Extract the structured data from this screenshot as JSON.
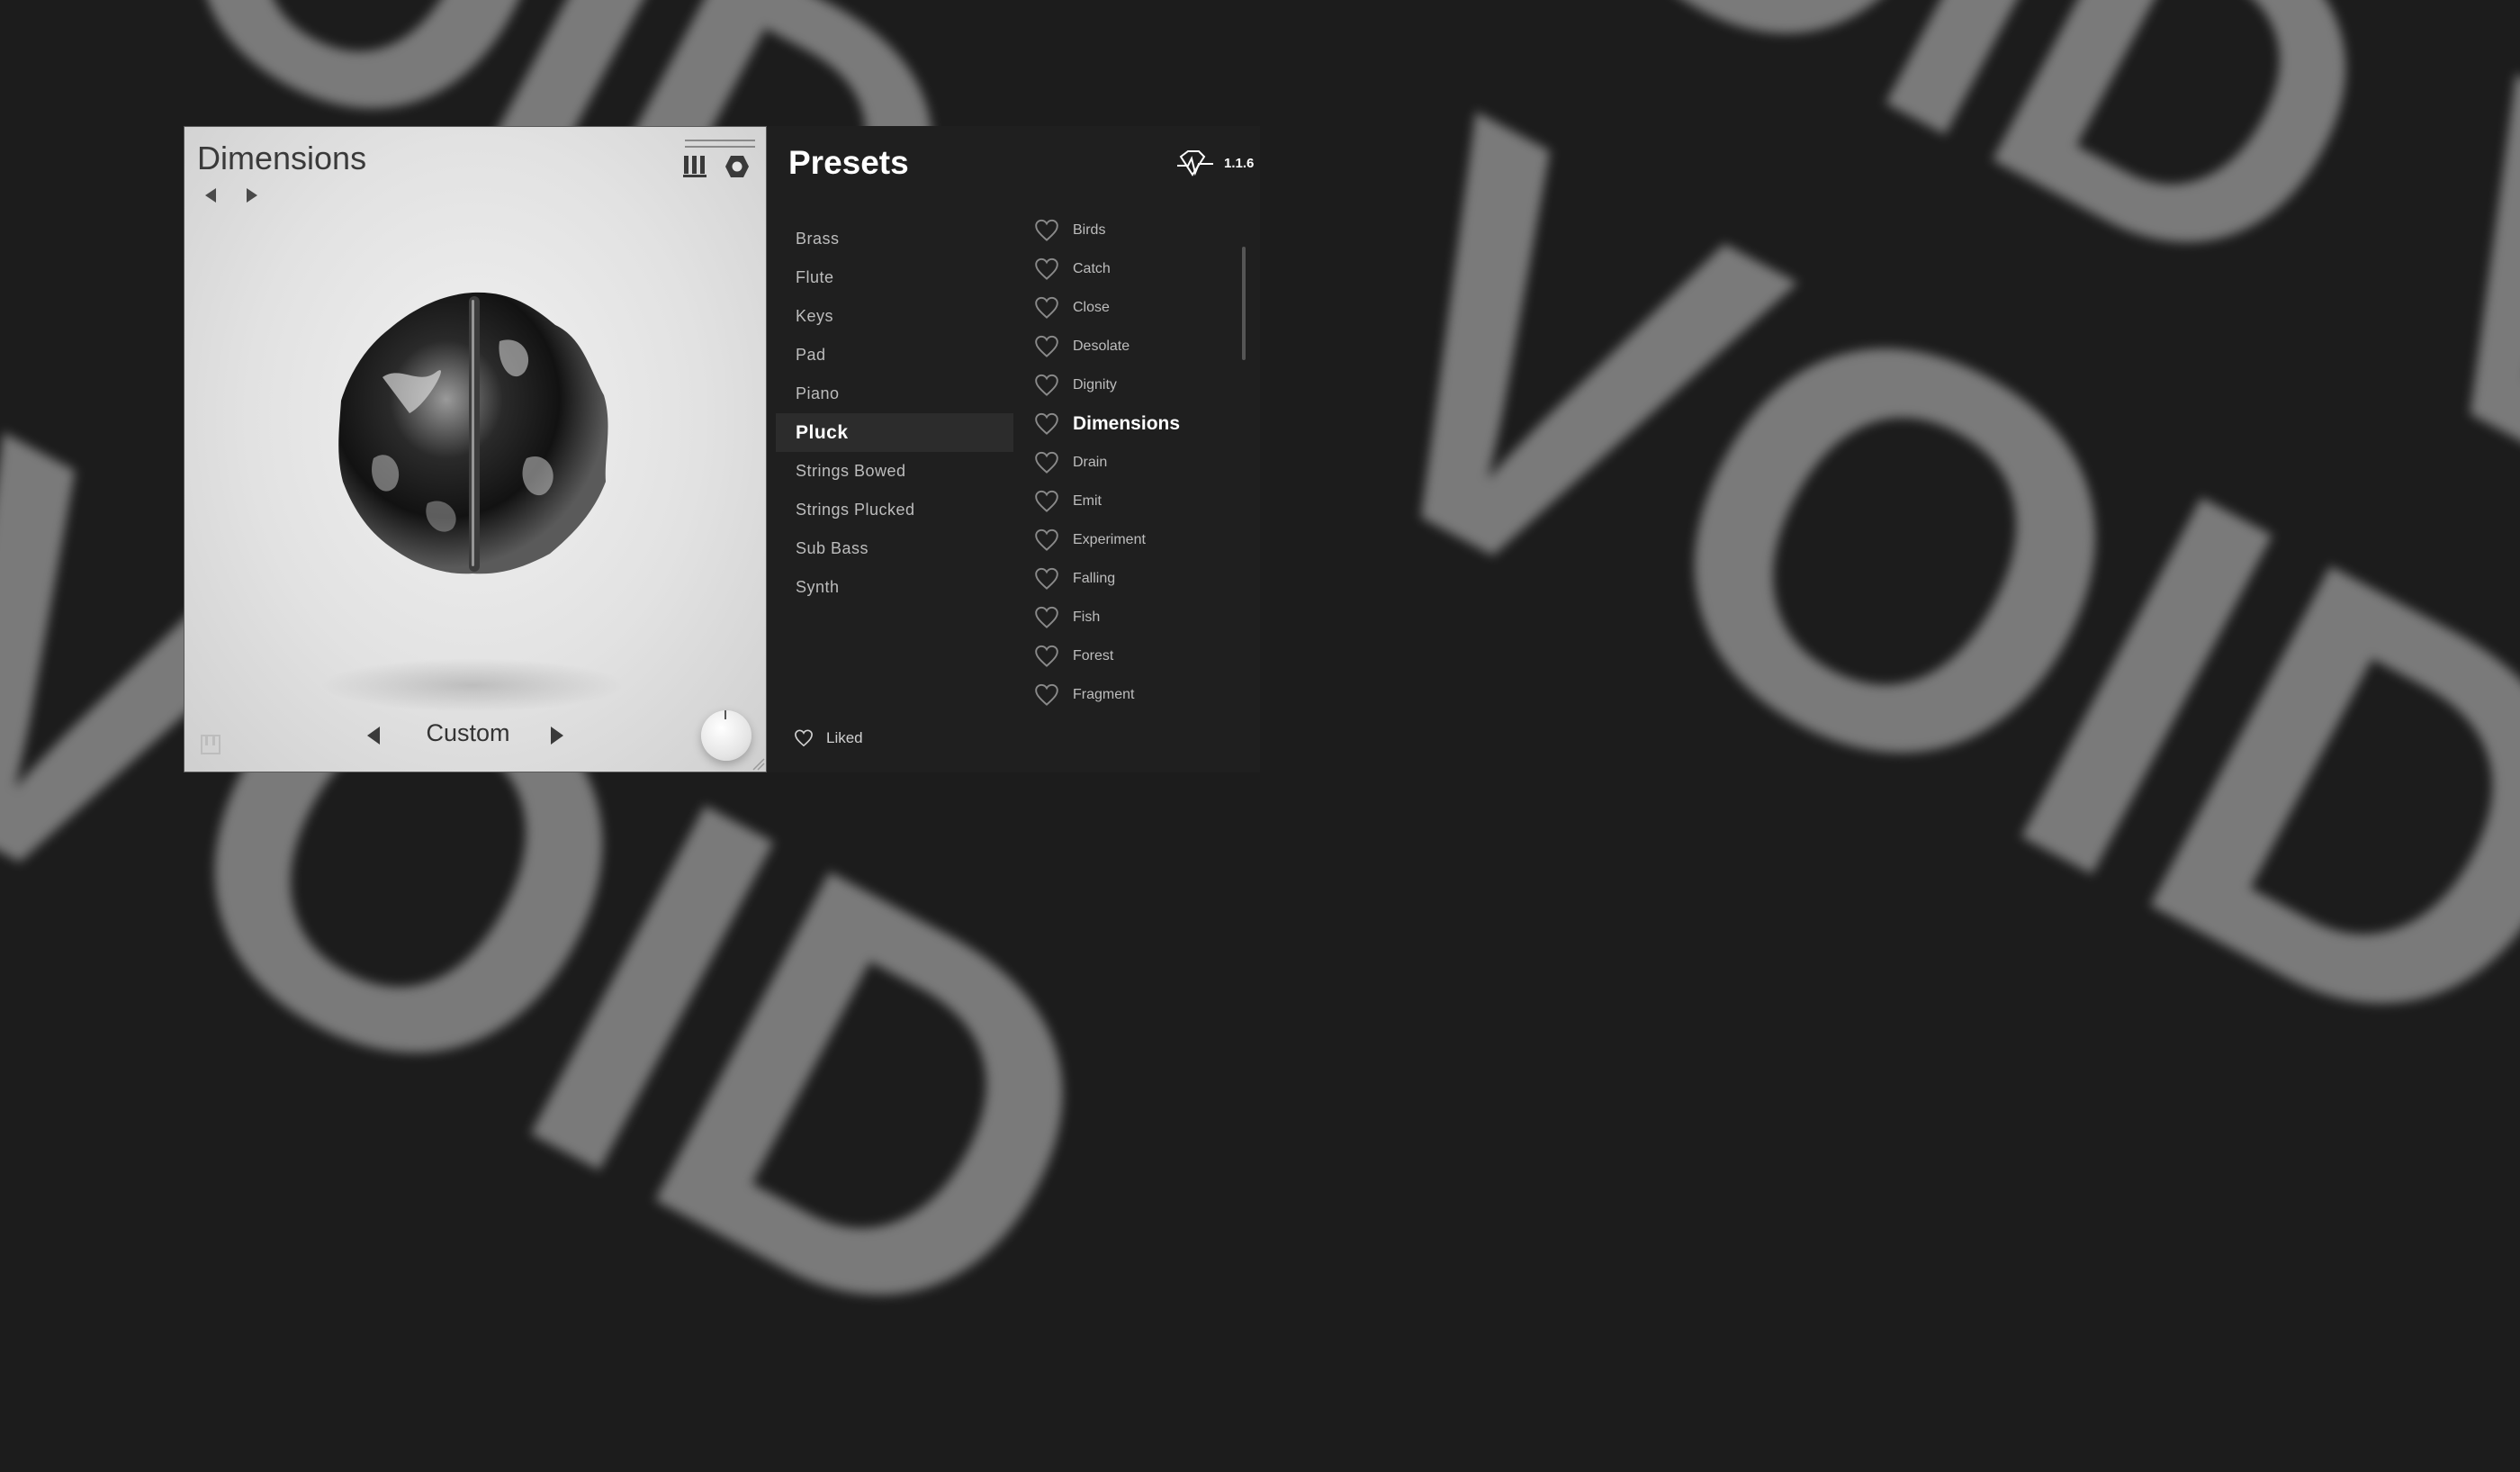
{
  "background": {
    "words": [
      "VOID",
      "VOID VO",
      "VOID",
      "VOID"
    ]
  },
  "plugin": {
    "title": "Dimensions",
    "mode_label": "Custom",
    "version": "1.1.6"
  },
  "presets_panel": {
    "title": "Presets",
    "categories": [
      "Brass",
      "Flute",
      "Keys",
      "Pad",
      "Piano",
      "Pluck",
      "Strings Bowed",
      "Strings Plucked",
      "Sub Bass",
      "Synth"
    ],
    "selected_category": "Pluck",
    "presets": [
      "Birds",
      "Catch",
      "Close",
      "Desolate",
      "Dignity",
      "Dimensions",
      "Drain",
      "Emit",
      "Experiment",
      "Falling",
      "Fish",
      "Forest",
      "Fragment"
    ],
    "selected_preset": "Dimensions",
    "liked_label": "Liked"
  },
  "colors": {
    "panel_dark": "#1f1f1f",
    "selected_row": "#2c2c2c",
    "text_light": "#bdbdbd",
    "text_white": "#ffffff"
  },
  "icons": [
    "browser-icon",
    "settings-icon",
    "chevron-left-icon",
    "chevron-right-icon",
    "piano-icon",
    "heart-icon",
    "logo-icon"
  ]
}
